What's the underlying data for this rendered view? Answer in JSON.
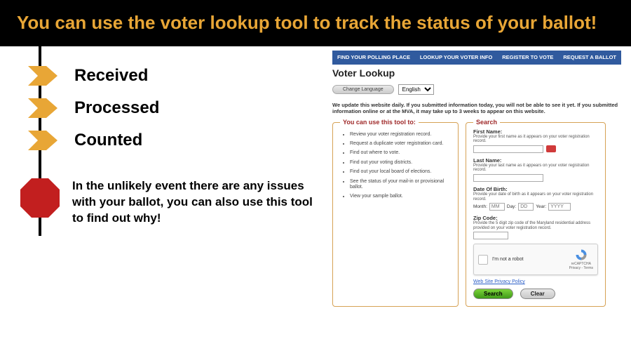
{
  "banner": "You can use the voter lookup tool to track the status of your ballot!",
  "steps": [
    "Received",
    "Processed",
    "Counted"
  ],
  "stop_text": "In the unlikely event there are any issues with your ballot, you can also use this tool to find out why!",
  "nav": [
    "FIND YOUR POLLING PLACE",
    "LOOKUP YOUR VOTER INFO",
    "REGISTER TO VOTE",
    "REQUEST A BALLOT"
  ],
  "page_title": "Voter Lookup",
  "lang_button": "Change Language",
  "lang_value": "English",
  "notice": "We update this website daily. If you submitted information today, you will not be able to see it yet. If you submitted information online or at the MVA, it may take up to 3 weeks to appear on this website.",
  "panel_uses_title": "You can use this tool to:",
  "uses": [
    "Review your voter registration record.",
    "Request a duplicate voter registration card.",
    "Find out where to vote.",
    "Find out your voting districts.",
    "Find out your local board of elections.",
    "See the status of your mail-in or provisional ballot.",
    "View your sample ballot."
  ],
  "panel_search_title": "Search",
  "fields": {
    "first": {
      "label": "First Name:",
      "hint": "Provide your first name as it appears on your voter registration record."
    },
    "last": {
      "label": "Last Name:",
      "hint": "Provide your last name as it appears on your voter registration record."
    },
    "dob": {
      "label": "Date Of Birth:",
      "hint": "Provide your date of birth as it appears on your voter registration record.",
      "month_l": "Month:",
      "day_l": "Day:",
      "year_l": "Year:",
      "month_ph": "MM",
      "day_ph": "DD",
      "year_ph": "YYYY"
    },
    "zip": {
      "label": "Zip Code:",
      "hint": "Provide the 5 digit zip code of the Maryland residential address provided on your voter registration record."
    }
  },
  "captcha": {
    "label": "I'm not a robot",
    "brand": "reCAPTCHA",
    "terms": "Privacy - Terms"
  },
  "policy": "Web Site Privacy Policy",
  "buttons": {
    "search": "Search",
    "clear": "Clear"
  }
}
